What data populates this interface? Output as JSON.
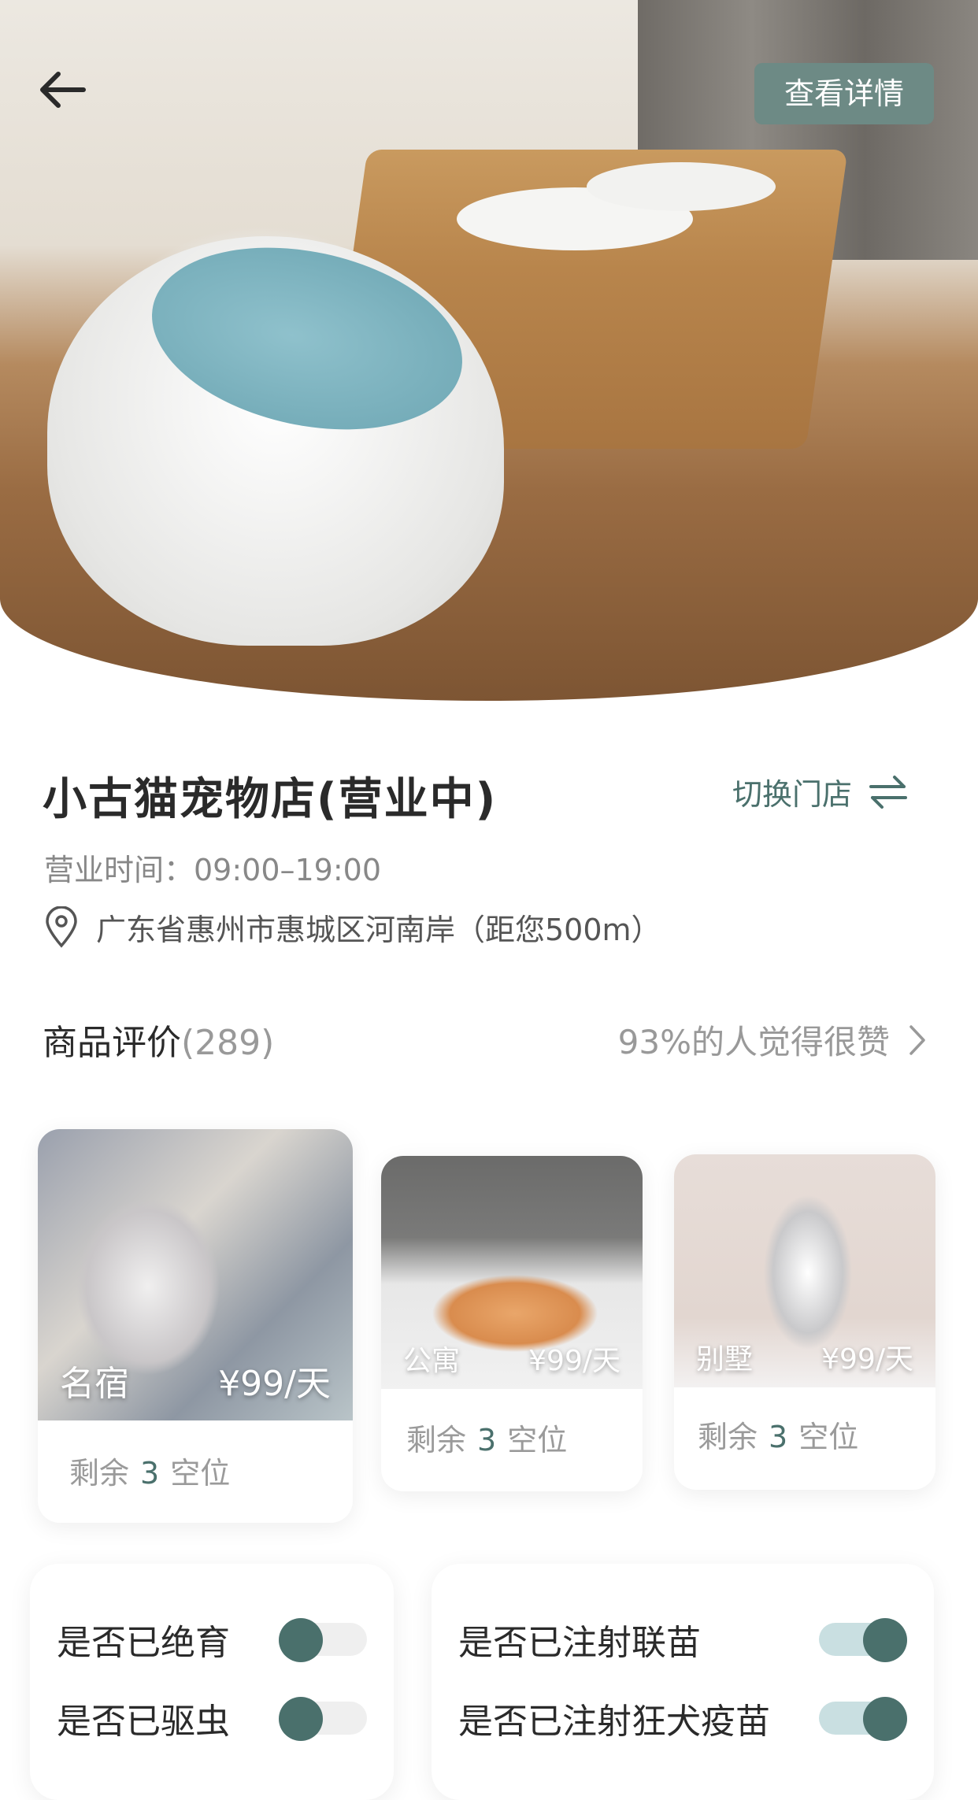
{
  "header": {
    "back_icon": "arrow-left-icon",
    "detail_button": "查看详情"
  },
  "store": {
    "name": "小古猫宠物店(营业中)",
    "switch_label": "切换门店",
    "switch_icon": "swap-icon",
    "hours": "营业时间：09:00–19:00",
    "location_icon": "location-pin-icon",
    "address": "广东省惠州市惠城区河南岸（距您500m）"
  },
  "reviews": {
    "label": "商品评价",
    "count": "(289)",
    "summary": "93%的人觉得很赞",
    "chevron_icon": "chevron-right-icon"
  },
  "rooms": [
    {
      "type": "名宿",
      "price": "¥99/天",
      "remaining_prefix": "剩余",
      "remaining": "3",
      "remaining_suffix": "空位"
    },
    {
      "type": "公寓",
      "price": "¥99/天",
      "remaining_prefix": "剩余",
      "remaining": "3",
      "remaining_suffix": "空位"
    },
    {
      "type": "别墅",
      "price": "¥99/天",
      "remaining_prefix": "剩余",
      "remaining": "3",
      "remaining_suffix": "空位"
    }
  ],
  "pet_status": {
    "left": [
      {
        "label": "是否已绝育",
        "on": false
      },
      {
        "label": "是否已驱虫",
        "on": false
      }
    ],
    "right": [
      {
        "label": "是否已注射联苗",
        "on": true
      },
      {
        "label": "是否已注射狂犬疫苗",
        "on": true
      }
    ]
  },
  "colors": {
    "accent": "#4a706c",
    "detail_button_bg": "#6d8a85",
    "toggle_on_track": "#c9dfe1",
    "toggle_off_track": "#efefef"
  }
}
